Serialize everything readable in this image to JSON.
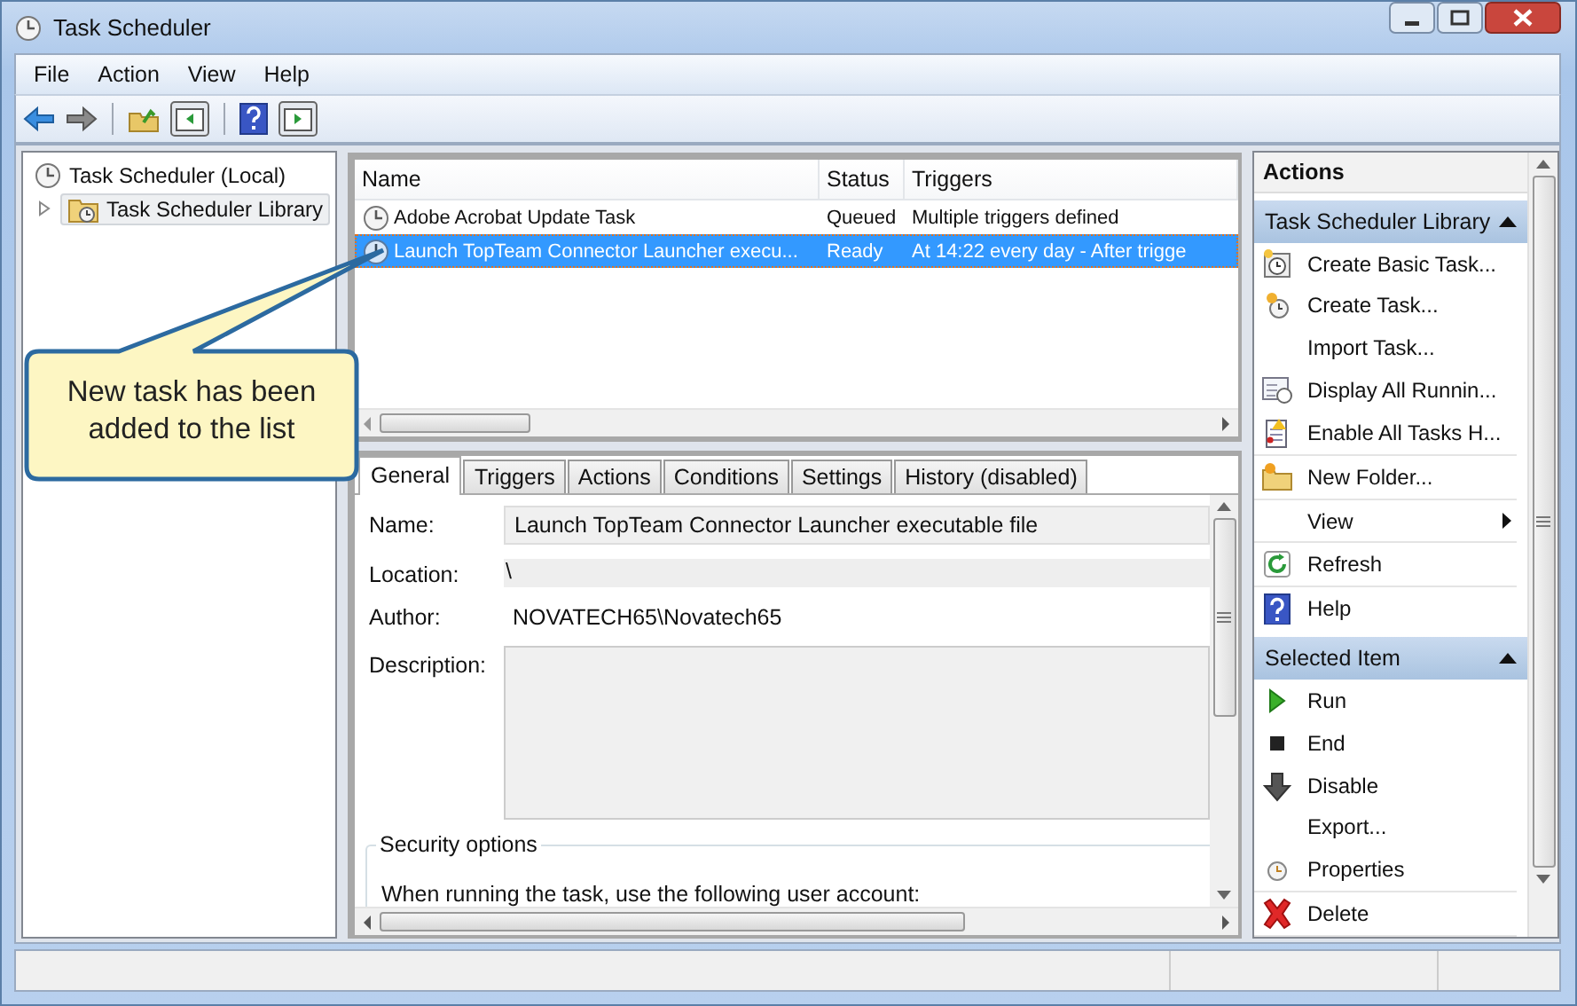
{
  "window": {
    "title": "Task Scheduler"
  },
  "menu": [
    "File",
    "Action",
    "View",
    "Help"
  ],
  "tree": [
    {
      "label": "Task Scheduler (Local)",
      "selected": false,
      "children": [
        {
          "label": "Task Scheduler Library",
          "selected": true,
          "expanded": false
        }
      ]
    }
  ],
  "task_list": {
    "columns": [
      "Name",
      "Status",
      "Triggers"
    ],
    "rows": [
      {
        "cells": [
          "Adobe Acrobat Update Task",
          "Queued",
          "Multiple triggers defined"
        ],
        "selected": false
      },
      {
        "cells": [
          "Launch TopTeam Connector Launcher execu...",
          "Ready",
          "At 14:22 every day - After trigge"
        ],
        "selected": true
      }
    ]
  },
  "details": {
    "tabs": [
      {
        "label": "General",
        "selected": true
      },
      {
        "label": "Triggers",
        "selected": false
      },
      {
        "label": "Actions",
        "selected": false
      },
      {
        "label": "Conditions",
        "selected": false
      },
      {
        "label": "Settings",
        "selected": false
      },
      {
        "label": "History (disabled)",
        "selected": false
      }
    ],
    "fields": [
      {
        "label": "Name:",
        "value": "Launch TopTeam Connector Launcher executable file",
        "kind": "box"
      },
      {
        "label": "Location:",
        "value": "\\",
        "kind": "shade"
      },
      {
        "label": "Author:",
        "value": "NOVATECH65\\Novatech65",
        "kind": "plain"
      },
      {
        "label": "Description:",
        "kind": "area"
      }
    ],
    "security_options": {
      "title": "Security options",
      "text": "When running the task, use the following user account:"
    }
  },
  "actions": {
    "title": "Actions",
    "sections": [
      {
        "title": "Task Scheduler Library",
        "expanded": true,
        "items": [
          {
            "label": "Create Basic Task...",
            "separator": false
          },
          {
            "label": "Create Task...",
            "separator": false
          },
          {
            "label": "Import Task...",
            "separator": false
          },
          {
            "label": "Display All Runnin...",
            "separator": false
          },
          {
            "label": "Enable All Tasks H...",
            "separator": true
          },
          {
            "label": "New Folder...",
            "separator": true
          },
          {
            "label": "View",
            "separator": true,
            "submenu": true
          },
          {
            "label": "Refresh",
            "separator": true
          },
          {
            "label": "Help",
            "separator": false
          }
        ]
      },
      {
        "title": "Selected Item",
        "expanded": true,
        "items": [
          {
            "label": "Run",
            "separator": false
          },
          {
            "label": "End",
            "separator": false
          },
          {
            "label": "Disable",
            "separator": false
          },
          {
            "label": "Export...",
            "separator": false
          },
          {
            "label": "Properties",
            "separator": true
          },
          {
            "label": "Delete",
            "separator": true
          }
        ]
      }
    ]
  },
  "callout": {
    "text": "New task has been added to the list"
  }
}
